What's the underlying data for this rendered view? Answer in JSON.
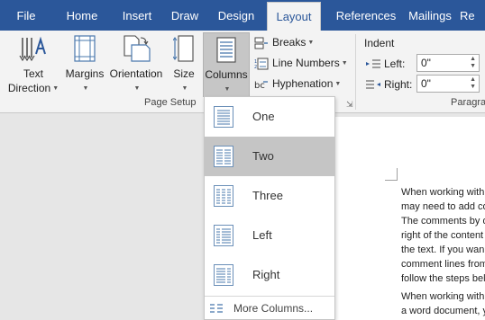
{
  "tabs": [
    "File",
    "Home",
    "Insert",
    "Draw",
    "Design",
    "Layout",
    "References",
    "Mailings",
    "Re"
  ],
  "active_tab": "Layout",
  "ribbon": {
    "text_direction": [
      "Text",
      "Direction"
    ],
    "margins": "Margins",
    "orientation": "Orientation",
    "size": "Size",
    "columns": "Columns",
    "breaks": "Breaks",
    "line_numbers": "Line Numbers",
    "hyphenation": "Hyphenation",
    "page_setup_group": "Page Setup",
    "indent_title": "Indent",
    "indent_left_label": "Left:",
    "indent_left_value": "0\"",
    "indent_right_label": "Right:",
    "indent_right_value": "0\"",
    "paragraph_group": "Paragra"
  },
  "columns_menu": {
    "items": [
      {
        "label": "One",
        "selected": false
      },
      {
        "label": "Two",
        "selected": true
      },
      {
        "label": "Three",
        "selected": false
      },
      {
        "label": "Left",
        "selected": false
      },
      {
        "label": "Right",
        "selected": false
      }
    ],
    "more": "More Columns..."
  },
  "document": {
    "lines": [
      "When working with",
      "may need to add co",
      "The comments by d",
      "right of the content",
      "the text. If you wan",
      "comment lines from",
      "follow the steps bel",
      "",
      "When working with",
      "a word document, y"
    ]
  },
  "colors": {
    "tabbar": "#2b579a",
    "ribbon": "#f3f3f3",
    "selected_item": "#c5c5c5",
    "icon_blue": "#4a78ad"
  }
}
